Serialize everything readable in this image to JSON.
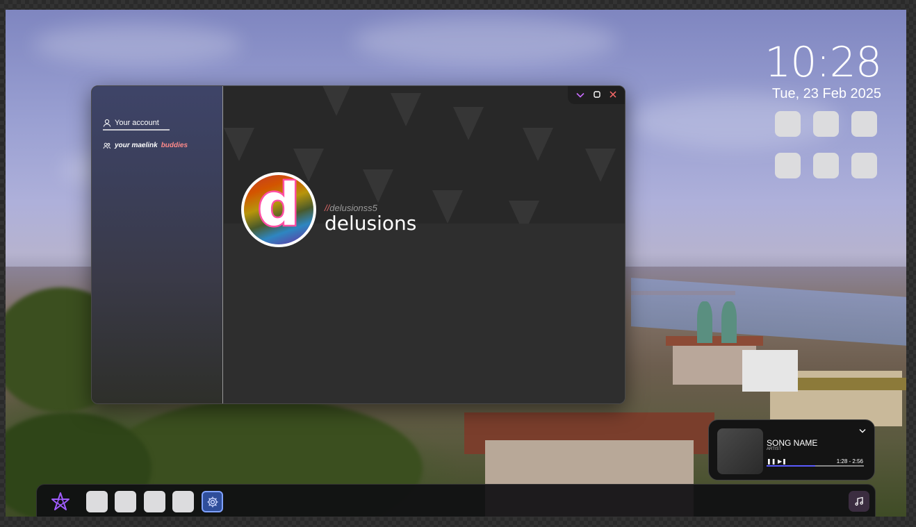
{
  "clock": {
    "time": "10:28",
    "date": "Tue, 23 Feb 2025"
  },
  "window": {
    "controls": {
      "minimize_icon": "chevron-down-icon",
      "maximize_icon": "square-icon",
      "close_icon": "close-icon",
      "colors": {
        "minimize": "#c86bff",
        "maximize": "#ffffff",
        "close": "#ff6b6b"
      }
    },
    "sidebar": {
      "account_label": "Your account",
      "buddies_prefix": "your maelink",
      "buddies_highlight": "buddies"
    },
    "profile": {
      "avatar_letter": "d",
      "handle_prefix": "//",
      "handle": "delusionss5",
      "display_name": "delusions"
    }
  },
  "music": {
    "song": "SONG NAME",
    "artist": "ARTIST",
    "elapsed": "1:28",
    "separator": "-",
    "duration": "2:56",
    "progress": 0.5
  },
  "taskbar": {
    "start_icon": "star-logo-icon",
    "apps": [
      "app-1",
      "app-2",
      "app-3",
      "app-4"
    ],
    "settings_icon": "gear-icon",
    "music_icon": "music-note-icon"
  },
  "colors": {
    "accent": "#a05cff",
    "highlight": "#ff8a8a"
  }
}
